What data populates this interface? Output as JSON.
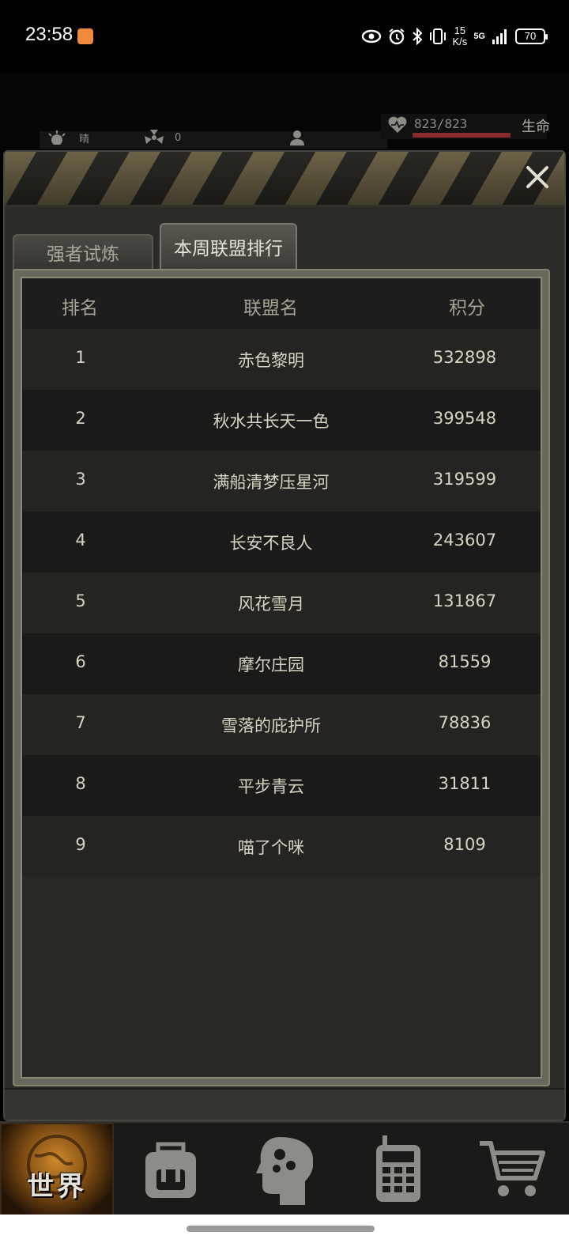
{
  "status_bar": {
    "time": "23:58",
    "net_speed_value": "15",
    "net_speed_unit": "K/s",
    "network": "5G",
    "battery": "70"
  },
  "hud": {
    "weather": "晴",
    "radiation": "0",
    "hp": "823/823",
    "hp_label": "生命"
  },
  "tabs": [
    {
      "label": "强者试炼",
      "active": false
    },
    {
      "label": "本周联盟排行",
      "active": true
    }
  ],
  "table": {
    "headers": {
      "rank": "排名",
      "name": "联盟名",
      "score": "积分"
    },
    "rows": [
      {
        "rank": "1",
        "name": "赤色黎明",
        "score": "532898"
      },
      {
        "rank": "2",
        "name": "秋水共长天一色",
        "score": "399548"
      },
      {
        "rank": "3",
        "name": "满船清梦压星河",
        "score": "319599"
      },
      {
        "rank": "4",
        "name": "长安不良人",
        "score": "243607"
      },
      {
        "rank": "5",
        "name": "风花雪月",
        "score": "131867"
      },
      {
        "rank": "6",
        "name": "摩尔庄园",
        "score": "81559"
      },
      {
        "rank": "7",
        "name": "雪落的庇护所",
        "score": "78836"
      },
      {
        "rank": "8",
        "name": "平步青云",
        "score": "31811"
      },
      {
        "rank": "9",
        "name": "喵了个咪",
        "score": "8109"
      }
    ]
  },
  "nav": {
    "world_label": "世界",
    "items": [
      "globe-icon",
      "backpack-icon",
      "skills-head-icon",
      "radio-icon",
      "cart-icon"
    ]
  },
  "colors": {
    "panel_bg": "#2c2b27",
    "hazard_yellow": "#6b6346",
    "hp_bar": "#8a2a2a",
    "world_accent": "#d08a2c"
  }
}
